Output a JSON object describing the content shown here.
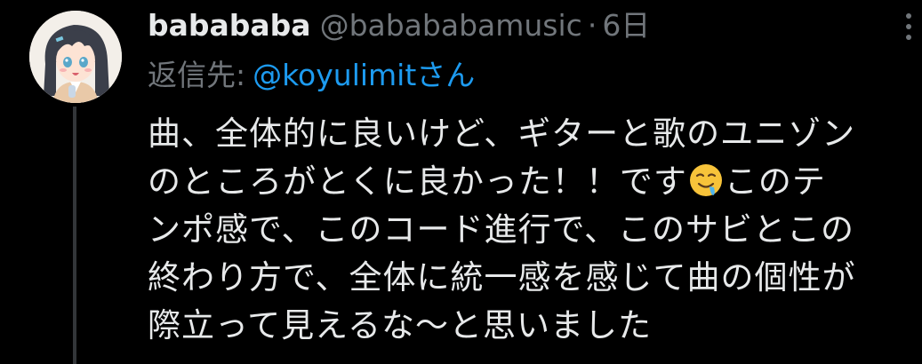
{
  "tweet": {
    "display_name": "babababa",
    "handle": "@babababamusic",
    "separator": "·",
    "time": "6日",
    "reply_prefix": "返信先:",
    "reply_to": "@koyulimitさん",
    "body_lines": [
      "曲、全体的に良いけど、ギターと歌のユニゾン",
      "のところがとくに良かった！！です",
      "このテ",
      "ンポ感で、このコード進行で、このサビとこの",
      "終わり方で、全体に統一感を感じて曲の個性が",
      "際立って見えるな〜と思いました"
    ],
    "emoji": "drooling-face-emoji",
    "avatar": "anime-girl-avatar",
    "menu_icon": "more-options-icon"
  },
  "colors": {
    "background": "#000000",
    "primary_text": "#e7e9ea",
    "secondary_text": "#71767b",
    "link": "#1d9bf0",
    "thread_line": "#333639"
  }
}
